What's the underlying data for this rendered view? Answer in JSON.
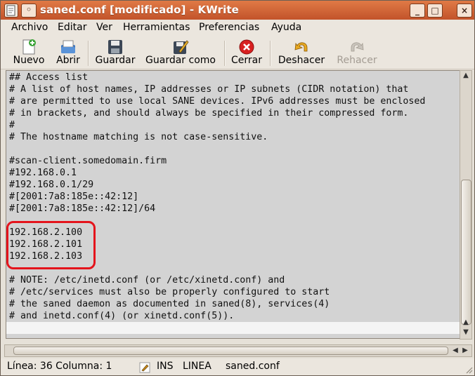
{
  "window": {
    "title": "saned.conf [modificado] - KWrite"
  },
  "menubar": {
    "items": [
      "Archivo",
      "Editar",
      "Ver",
      "Herramientas",
      "Preferencias",
      "Ayuda"
    ]
  },
  "toolbar": {
    "nuevo": "Nuevo",
    "abrir": "Abrir",
    "guardar": "Guardar",
    "guardar_como": "Guardar como",
    "cerrar": "Cerrar",
    "deshacer": "Deshacer",
    "rehacer": "Rehacer"
  },
  "editor": {
    "lines": [
      "## Access list",
      "# A list of host names, IP addresses or IP subnets (CIDR notation) that",
      "# are permitted to use local SANE devices. IPv6 addresses must be enclosed",
      "# in brackets, and should always be specified in their compressed form.",
      "#",
      "# The hostname matching is not case-sensitive.",
      "",
      "#scan-client.somedomain.firm",
      "#192.168.0.1",
      "#192.168.0.1/29",
      "#[2001:7a8:185e::42:12]",
      "#[2001:7a8:185e::42:12]/64",
      "",
      "192.168.2.100",
      "192.168.2.101",
      "192.168.2.103",
      "",
      "# NOTE: /etc/inetd.conf (or /etc/xinetd.conf) and",
      "# /etc/services must also be properly configured to start",
      "# the saned daemon as documented in saned(8), services(4)",
      "# and inetd.conf(4) (or xinetd.conf(5)).",
      ""
    ]
  },
  "statusbar": {
    "position": "Línea: 36 Columna: 1",
    "mode": "INS",
    "wrap": "LINEA",
    "filename": "saned.conf"
  },
  "colors": {
    "highlight_ring": "#e4141c",
    "titlebar": "#d0673a",
    "cerrar_icon": "#d82020"
  }
}
